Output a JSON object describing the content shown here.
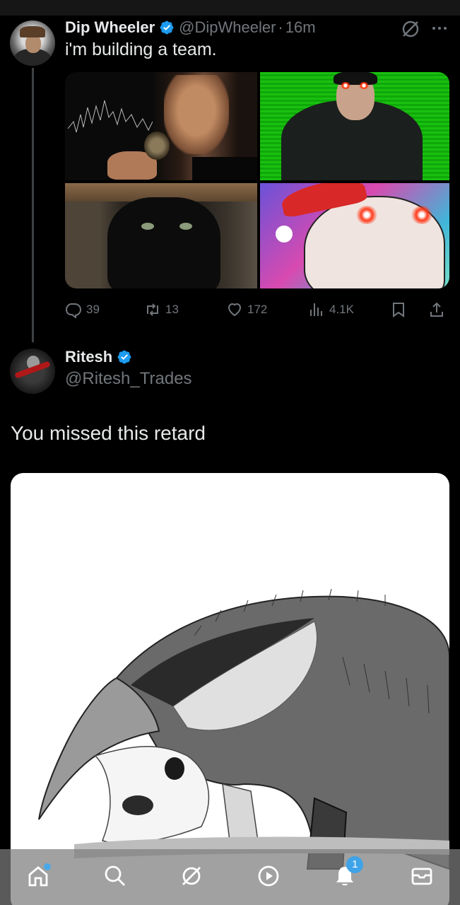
{
  "parent_tweet": {
    "display_name": "Dip Wheeler",
    "handle": "@DipWheeler",
    "separator": "·",
    "time": "16m",
    "text": "i'm building a team.",
    "images": [
      {
        "label": "godfather-image"
      },
      {
        "label": "neo-image"
      },
      {
        "label": "black-cat-image"
      },
      {
        "label": "santa-pepe-image"
      }
    ],
    "actions": {
      "replies": "39",
      "reposts": "13",
      "likes": "172",
      "views": "4.1K"
    }
  },
  "reply_tweet": {
    "display_name": "Ritesh",
    "handle": "@Ritesh_Trades",
    "text": "You missed this retard",
    "image": {
      "label": "anteater-drawing"
    }
  },
  "bottom_nav": {
    "items": [
      {
        "icon": "home-icon"
      },
      {
        "icon": "search-icon"
      },
      {
        "icon": "grok-icon"
      },
      {
        "icon": "video-icon"
      },
      {
        "icon": "notifications-icon"
      },
      {
        "icon": "messages-icon"
      }
    ],
    "notification_count": "1"
  },
  "colors": {
    "background": "#000000",
    "text_primary": "#e7e9ea",
    "text_secondary": "#71767b",
    "verified": "#1d9bf0",
    "nav_badge": "#3fa3e8"
  }
}
